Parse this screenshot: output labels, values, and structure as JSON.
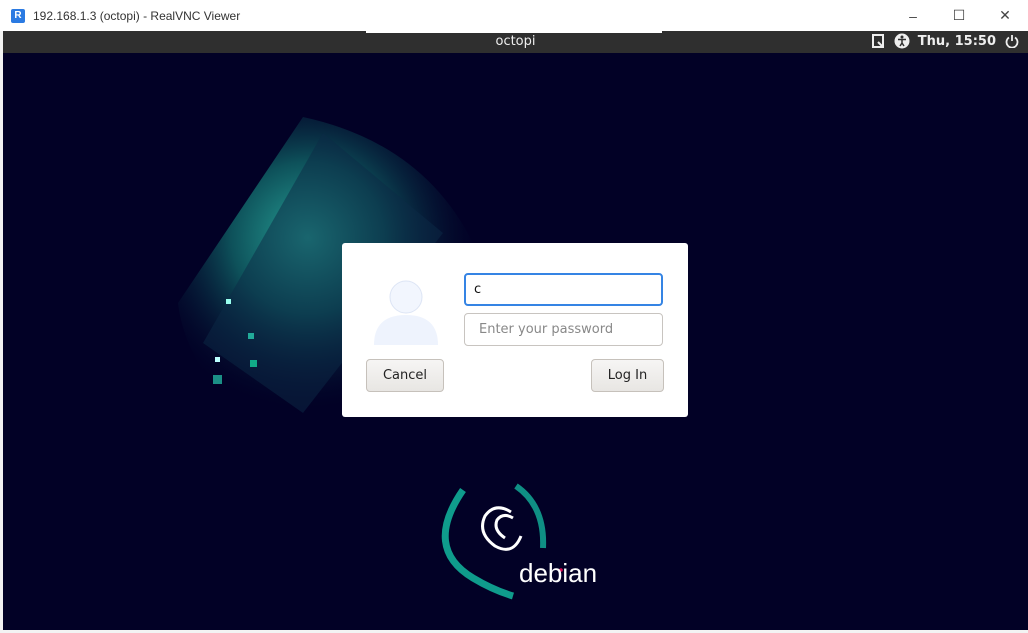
{
  "window": {
    "title": "192.168.1.3 (octopi) - RealVNC Viewer",
    "minimize": "–",
    "maximize": "☐",
    "close": "✕",
    "app_icon": "realvnc-icon"
  },
  "panel": {
    "hostname": "octopi",
    "clock": "Thu, 15:50",
    "icons": [
      "screenshot-icon",
      "accessibility-icon",
      "power-icon"
    ]
  },
  "login": {
    "username_value": "c",
    "password_placeholder": "Enter your password",
    "cancel_label": "Cancel",
    "login_label": "Log In"
  },
  "branding": {
    "logo_text": "debian"
  },
  "colors": {
    "accent": "#3584e4",
    "desktop": "#020126",
    "teal": "#0f9c8c"
  }
}
